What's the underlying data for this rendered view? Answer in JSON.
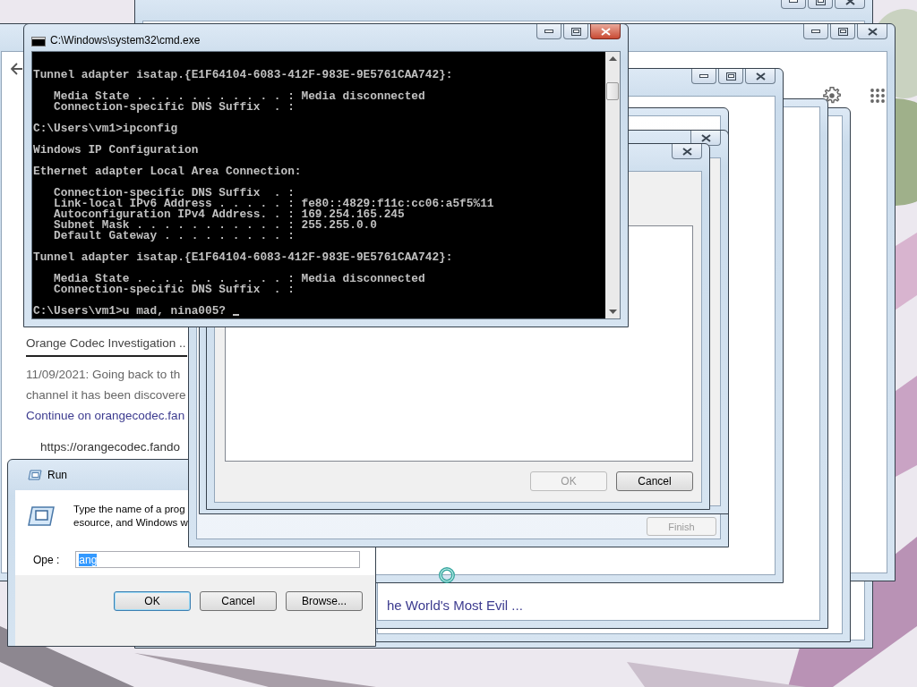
{
  "cmd": {
    "title": "C:\\Windows\\system32\\cmd.exe",
    "blocks": [
      [
        "Tunnel adapter isatap.{E1F64104-6083-412F-983E-9E5761CAA742}:"
      ],
      [
        "   Media State . . . . . . . . . . . : Media disconnected",
        "   Connection-specific DNS Suffix  . :"
      ],
      [
        "C:\\Users\\vm1>ipconfig"
      ],
      [
        "Windows IP Configuration"
      ],
      [
        "Ethernet adapter Local Area Connection:"
      ],
      [
        "   Connection-specific DNS Suffix  . :",
        "   Link-local IPv6 Address . . . . . : fe80::4829:f11c:cc06:a5f5%11",
        "   Autoconfiguration IPv4 Address. . : 169.254.165.245",
        "   Subnet Mask . . . . . . . . . . . : 255.255.0.0",
        "   Default Gateway . . . . . . . . . :"
      ],
      [
        "Tunnel adapter isatap.{E1F64104-6083-412F-983E-9E5761CAA742}:"
      ],
      [
        "   Media State . . . . . . . . . . . : Media disconnected",
        "   Connection-specific DNS Suffix  . :"
      ],
      [
        "C:\\Users\\vm1>u mad, nina005?"
      ]
    ]
  },
  "browser": {
    "heading": "Orange Codec Investigation ..",
    "snippet": [
      "11/09/2021: Going back to th",
      "channel it has been discovere"
    ],
    "link": "Continue on orangecodec.fan",
    "url": "https://orangecodec.fando",
    "bottom_link": "he World's Most Evil ..."
  },
  "run": {
    "title": "Run",
    "description": [
      "Type the name of a prog",
      "esource, and Windows w"
    ],
    "open_label": "Ope :",
    "open_field": {
      "value": "ang",
      "selected": true
    },
    "buttons": [
      {
        "label": "OK",
        "default": true
      },
      {
        "label": "Cancel",
        "default": false
      },
      {
        "label": "Browse...",
        "default": false
      }
    ]
  },
  "dialog": {
    "buttons": [
      {
        "label": "OK",
        "disabled": true
      },
      {
        "label": "Cancel",
        "disabled": false
      }
    ]
  },
  "wizard": {
    "buttons": [
      {
        "label": "Finish",
        "disabled": true
      }
    ]
  }
}
